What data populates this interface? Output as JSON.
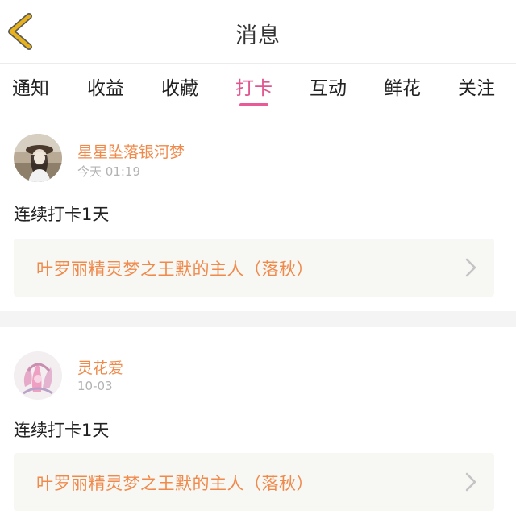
{
  "header": {
    "title": "消息",
    "back_icon": "chevron-left-icon",
    "back_color": "#e8b21c"
  },
  "tabs": [
    {
      "label": "通知",
      "active": false
    },
    {
      "label": "收益",
      "active": false
    },
    {
      "label": "收藏",
      "active": false
    },
    {
      "label": "打卡",
      "active": true
    },
    {
      "label": "互动",
      "active": false
    },
    {
      "label": "鲜花",
      "active": false
    },
    {
      "label": "关注",
      "active": false
    }
  ],
  "colors": {
    "accent_pink": "#e0548f",
    "username_orange": "#f08a4b",
    "link_orange": "#f08a4b",
    "card_bg": "#f7f7f4",
    "divider_bg": "#f4f4f4"
  },
  "posts": [
    {
      "username": "星星坠落银河梦",
      "timestamp": "今天 01:19",
      "text": "连续打卡1天",
      "link": "叶罗丽精灵梦之王默的主人（落秋）",
      "avatar_icon": "user-avatar"
    },
    {
      "username": "灵花爱",
      "timestamp": "10-03",
      "text": "连续打卡1天",
      "link": "叶罗丽精灵梦之王默的主人（落秋）",
      "avatar_icon": "user-avatar"
    }
  ]
}
